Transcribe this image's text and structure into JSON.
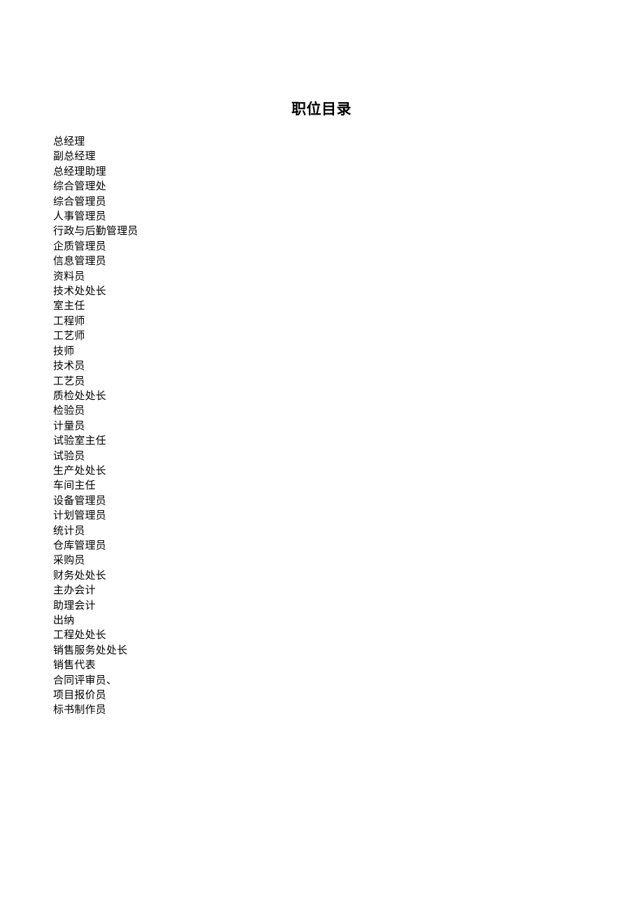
{
  "document": {
    "title": "职位目录",
    "background_color": "#ffffff",
    "text_color": "#000000"
  },
  "positions": [
    {
      "label": "总经理"
    },
    {
      "label": "副总经理"
    },
    {
      "label": "总经理助理"
    },
    {
      "label": "综合管理处"
    },
    {
      "label": "综合管理员"
    },
    {
      "label": "人事管理员"
    },
    {
      "label": "行政与后勤管理员"
    },
    {
      "label": "企质管理员"
    },
    {
      "label": "信息管理员"
    },
    {
      "label": "资料员"
    },
    {
      "label": "技术处处长"
    },
    {
      "label": "室主任"
    },
    {
      "label": "工程师"
    },
    {
      "label": "工艺师"
    },
    {
      "label": "技师"
    },
    {
      "label": "技术员"
    },
    {
      "label": "工艺员"
    },
    {
      "label": "质检处处长"
    },
    {
      "label": "检验员"
    },
    {
      "label": "计量员"
    },
    {
      "label": "试验室主任"
    },
    {
      "label": "试验员"
    },
    {
      "label": "生产处处长"
    },
    {
      "label": "车间主任"
    },
    {
      "label": "设备管理员"
    },
    {
      "label": "计划管理员"
    },
    {
      "label": "统计员"
    },
    {
      "label": "仓库管理员"
    },
    {
      "label": "采购员"
    },
    {
      "label": "财务处处长"
    },
    {
      "label": "主办会计"
    },
    {
      "label": "助理会计"
    },
    {
      "label": "出纳"
    },
    {
      "label": "工程处处长"
    },
    {
      "label": "销售服务处处长"
    },
    {
      "label": "销售代表"
    },
    {
      "label": "合同评审员、"
    },
    {
      "label": "项目报价员"
    },
    {
      "label": "标书制作员"
    }
  ]
}
